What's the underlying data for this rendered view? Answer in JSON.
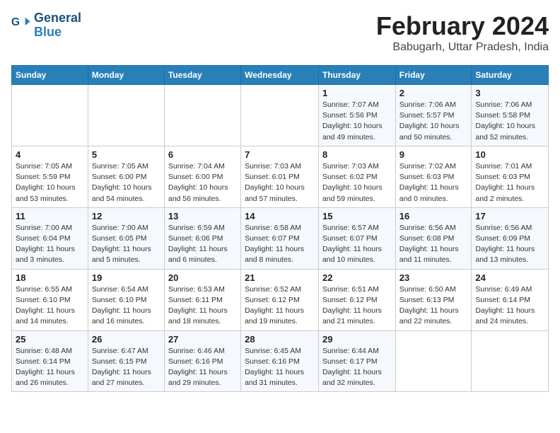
{
  "logo": {
    "line1": "General",
    "line2": "Blue"
  },
  "title": "February 2024",
  "location": "Babugarh, Uttar Pradesh, India",
  "days_header": [
    "Sunday",
    "Monday",
    "Tuesday",
    "Wednesday",
    "Thursday",
    "Friday",
    "Saturday"
  ],
  "weeks": [
    [
      {
        "day": "",
        "sunrise": "",
        "sunset": "",
        "daylight": ""
      },
      {
        "day": "",
        "sunrise": "",
        "sunset": "",
        "daylight": ""
      },
      {
        "day": "",
        "sunrise": "",
        "sunset": "",
        "daylight": ""
      },
      {
        "day": "",
        "sunrise": "",
        "sunset": "",
        "daylight": ""
      },
      {
        "day": "1",
        "sunrise": "Sunrise: 7:07 AM",
        "sunset": "Sunset: 5:56 PM",
        "daylight": "Daylight: 10 hours and 49 minutes."
      },
      {
        "day": "2",
        "sunrise": "Sunrise: 7:06 AM",
        "sunset": "Sunset: 5:57 PM",
        "daylight": "Daylight: 10 hours and 50 minutes."
      },
      {
        "day": "3",
        "sunrise": "Sunrise: 7:06 AM",
        "sunset": "Sunset: 5:58 PM",
        "daylight": "Daylight: 10 hours and 52 minutes."
      }
    ],
    [
      {
        "day": "4",
        "sunrise": "Sunrise: 7:05 AM",
        "sunset": "Sunset: 5:59 PM",
        "daylight": "Daylight: 10 hours and 53 minutes."
      },
      {
        "day": "5",
        "sunrise": "Sunrise: 7:05 AM",
        "sunset": "Sunset: 6:00 PM",
        "daylight": "Daylight: 10 hours and 54 minutes."
      },
      {
        "day": "6",
        "sunrise": "Sunrise: 7:04 AM",
        "sunset": "Sunset: 6:00 PM",
        "daylight": "Daylight: 10 hours and 56 minutes."
      },
      {
        "day": "7",
        "sunrise": "Sunrise: 7:03 AM",
        "sunset": "Sunset: 6:01 PM",
        "daylight": "Daylight: 10 hours and 57 minutes."
      },
      {
        "day": "8",
        "sunrise": "Sunrise: 7:03 AM",
        "sunset": "Sunset: 6:02 PM",
        "daylight": "Daylight: 10 hours and 59 minutes."
      },
      {
        "day": "9",
        "sunrise": "Sunrise: 7:02 AM",
        "sunset": "Sunset: 6:03 PM",
        "daylight": "Daylight: 11 hours and 0 minutes."
      },
      {
        "day": "10",
        "sunrise": "Sunrise: 7:01 AM",
        "sunset": "Sunset: 6:03 PM",
        "daylight": "Daylight: 11 hours and 2 minutes."
      }
    ],
    [
      {
        "day": "11",
        "sunrise": "Sunrise: 7:00 AM",
        "sunset": "Sunset: 6:04 PM",
        "daylight": "Daylight: 11 hours and 3 minutes."
      },
      {
        "day": "12",
        "sunrise": "Sunrise: 7:00 AM",
        "sunset": "Sunset: 6:05 PM",
        "daylight": "Daylight: 11 hours and 5 minutes."
      },
      {
        "day": "13",
        "sunrise": "Sunrise: 6:59 AM",
        "sunset": "Sunset: 6:06 PM",
        "daylight": "Daylight: 11 hours and 6 minutes."
      },
      {
        "day": "14",
        "sunrise": "Sunrise: 6:58 AM",
        "sunset": "Sunset: 6:07 PM",
        "daylight": "Daylight: 11 hours and 8 minutes."
      },
      {
        "day": "15",
        "sunrise": "Sunrise: 6:57 AM",
        "sunset": "Sunset: 6:07 PM",
        "daylight": "Daylight: 11 hours and 10 minutes."
      },
      {
        "day": "16",
        "sunrise": "Sunrise: 6:56 AM",
        "sunset": "Sunset: 6:08 PM",
        "daylight": "Daylight: 11 hours and 11 minutes."
      },
      {
        "day": "17",
        "sunrise": "Sunrise: 6:56 AM",
        "sunset": "Sunset: 6:09 PM",
        "daylight": "Daylight: 11 hours and 13 minutes."
      }
    ],
    [
      {
        "day": "18",
        "sunrise": "Sunrise: 6:55 AM",
        "sunset": "Sunset: 6:10 PM",
        "daylight": "Daylight: 11 hours and 14 minutes."
      },
      {
        "day": "19",
        "sunrise": "Sunrise: 6:54 AM",
        "sunset": "Sunset: 6:10 PM",
        "daylight": "Daylight: 11 hours and 16 minutes."
      },
      {
        "day": "20",
        "sunrise": "Sunrise: 6:53 AM",
        "sunset": "Sunset: 6:11 PM",
        "daylight": "Daylight: 11 hours and 18 minutes."
      },
      {
        "day": "21",
        "sunrise": "Sunrise: 6:52 AM",
        "sunset": "Sunset: 6:12 PM",
        "daylight": "Daylight: 11 hours and 19 minutes."
      },
      {
        "day": "22",
        "sunrise": "Sunrise: 6:51 AM",
        "sunset": "Sunset: 6:12 PM",
        "daylight": "Daylight: 11 hours and 21 minutes."
      },
      {
        "day": "23",
        "sunrise": "Sunrise: 6:50 AM",
        "sunset": "Sunset: 6:13 PM",
        "daylight": "Daylight: 11 hours and 22 minutes."
      },
      {
        "day": "24",
        "sunrise": "Sunrise: 6:49 AM",
        "sunset": "Sunset: 6:14 PM",
        "daylight": "Daylight: 11 hours and 24 minutes."
      }
    ],
    [
      {
        "day": "25",
        "sunrise": "Sunrise: 6:48 AM",
        "sunset": "Sunset: 6:14 PM",
        "daylight": "Daylight: 11 hours and 26 minutes."
      },
      {
        "day": "26",
        "sunrise": "Sunrise: 6:47 AM",
        "sunset": "Sunset: 6:15 PM",
        "daylight": "Daylight: 11 hours and 27 minutes."
      },
      {
        "day": "27",
        "sunrise": "Sunrise: 6:46 AM",
        "sunset": "Sunset: 6:16 PM",
        "daylight": "Daylight: 11 hours and 29 minutes."
      },
      {
        "day": "28",
        "sunrise": "Sunrise: 6:45 AM",
        "sunset": "Sunset: 6:16 PM",
        "daylight": "Daylight: 11 hours and 31 minutes."
      },
      {
        "day": "29",
        "sunrise": "Sunrise: 6:44 AM",
        "sunset": "Sunset: 6:17 PM",
        "daylight": "Daylight: 11 hours and 32 minutes."
      },
      {
        "day": "",
        "sunrise": "",
        "sunset": "",
        "daylight": ""
      },
      {
        "day": "",
        "sunrise": "",
        "sunset": "",
        "daylight": ""
      }
    ]
  ]
}
